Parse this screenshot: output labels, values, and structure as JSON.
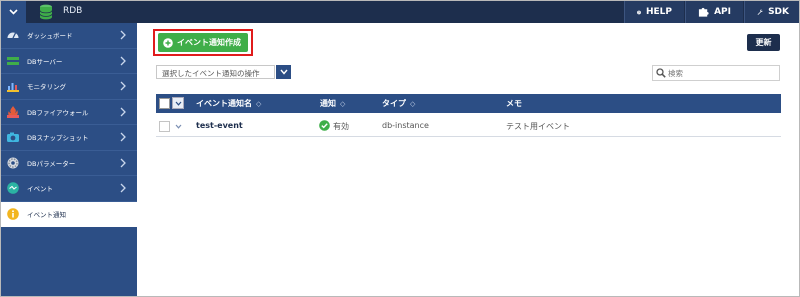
{
  "app": {
    "title": "RDB"
  },
  "topnav": {
    "help_label": "HELP",
    "api_label": "API",
    "sdk_label": "SDK"
  },
  "sidebar": {
    "items": [
      {
        "label": "ダッシュボード",
        "icon": "gauge-icon"
      },
      {
        "label": "DBサーバー",
        "icon": "server-icon"
      },
      {
        "label": "モニタリング",
        "icon": "chart-icon"
      },
      {
        "label": "DBファイアウォール",
        "icon": "firewall-icon"
      },
      {
        "label": "DBスナップショット",
        "icon": "camera-icon"
      },
      {
        "label": "DBパラメーター",
        "icon": "gear-icon"
      },
      {
        "label": "イベント",
        "icon": "event-icon"
      },
      {
        "label": "イベント通知",
        "icon": "info-icon"
      }
    ]
  },
  "toolbar": {
    "create_label": "イベント通知作成",
    "refresh_label": "更新",
    "bulk_action_label": "選択したイベント通知の操作",
    "search_placeholder": "検索"
  },
  "table": {
    "headers": {
      "name": "イベント通知名",
      "notify": "通知",
      "type": "タイプ",
      "memo": "メモ"
    },
    "rows": [
      {
        "name": "test-event",
        "notify": "有効",
        "type": "db-instance",
        "memo": "テスト用イベント"
      }
    ]
  },
  "colors": {
    "topbar": "#1d2e4d",
    "sidebar": "#2c4e85",
    "create_button": "#3fae49",
    "highlight_border": "#e01b1b"
  }
}
